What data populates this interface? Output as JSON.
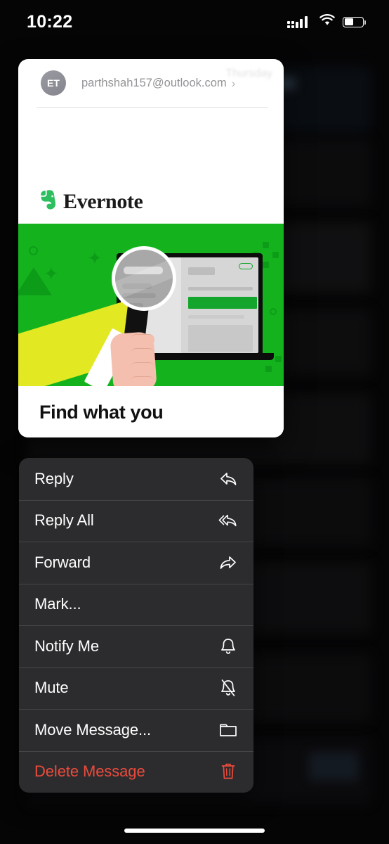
{
  "status_bar": {
    "time": "10:22",
    "cellular_icon": "cellular-signal-icon",
    "wifi_icon": "wifi-icon",
    "battery_icon": "battery-icon",
    "battery_level_percent": 50
  },
  "mail_card": {
    "avatar_initials": "ET",
    "sender_email": "parthshah157@outlook.com",
    "disclosure_icon": "chevron-right-icon",
    "date_label": "Thursday",
    "brand_name": "Evernote",
    "brand_logo_icon": "evernote-elephant-icon",
    "headline": "Find what you",
    "hero_illustration": {
      "background_color": "#14b31e",
      "accent_color": "#0d9c18",
      "sleeve_color": "#e2e821",
      "skin_color": "#f4bfae",
      "device_color": "#0c0c0c",
      "screen_color": "#d6d6d6",
      "highlight_color": "#14a52c",
      "magnifier_icon": "magnifying-glass-icon",
      "laptop_icon": "laptop-icon",
      "hand_icon": "hand-icon"
    }
  },
  "context_menu": {
    "items": [
      {
        "label": "Reply",
        "icon": "reply-arrow-icon",
        "danger": false
      },
      {
        "label": "Reply All",
        "icon": "reply-all-arrow-icon",
        "danger": false
      },
      {
        "label": "Forward",
        "icon": "forward-arrow-icon",
        "danger": false
      },
      {
        "label": "Mark...",
        "icon": "",
        "danger": false
      },
      {
        "label": "Notify Me",
        "icon": "bell-icon",
        "danger": false
      },
      {
        "label": "Mute",
        "icon": "bell-slash-icon",
        "danger": false
      },
      {
        "label": "Move Message...",
        "icon": "folder-icon",
        "danger": false
      },
      {
        "label": "Delete Message",
        "icon": "trash-icon",
        "danger": true
      }
    ],
    "background_color": "#2c2c2e",
    "danger_color": "#eb4b3c"
  },
  "home_indicator": "home-indicator"
}
